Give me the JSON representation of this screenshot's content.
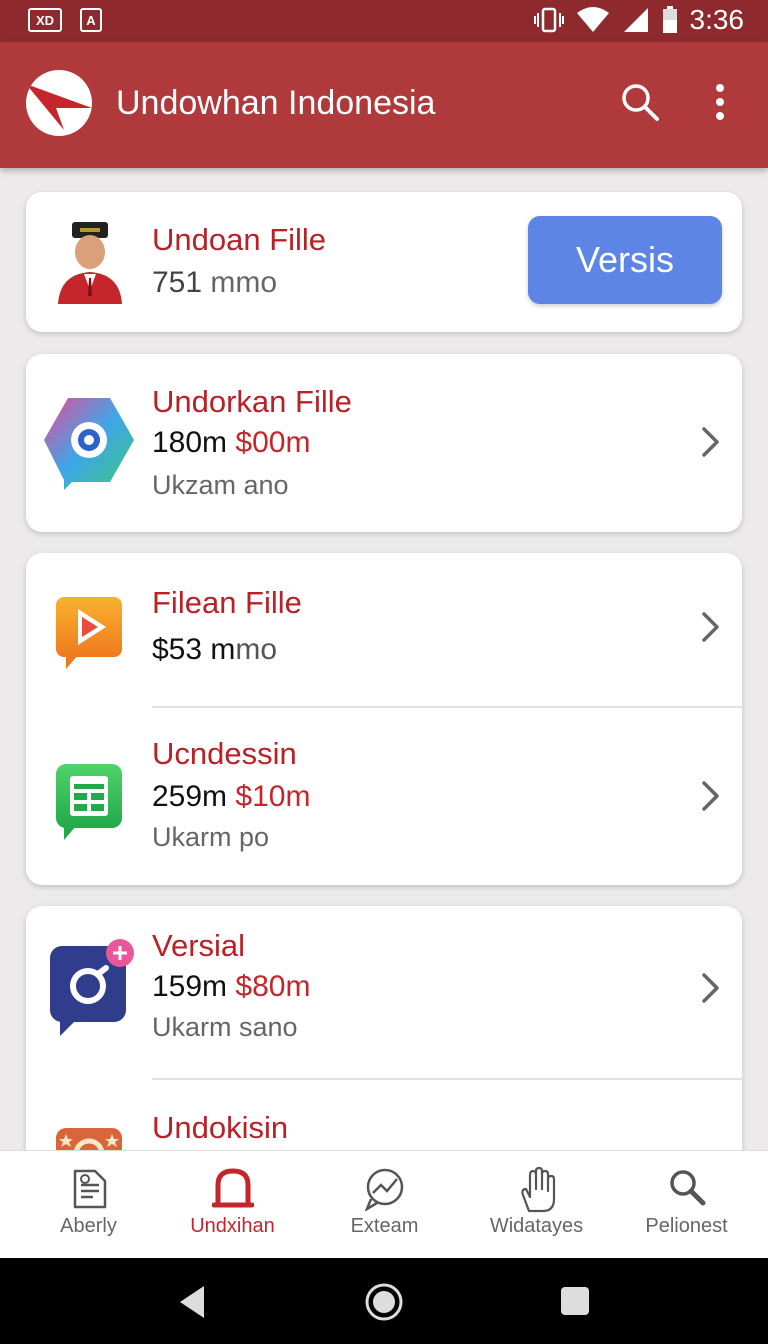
{
  "status_bar": {
    "left_badge_1": "XD",
    "left_badge_2": "A",
    "time": "3:36"
  },
  "app_bar": {
    "title": "Undowhan Indonesia",
    "icons": [
      "logo",
      "search-icon",
      "more-vert-icon"
    ]
  },
  "items": [
    {
      "title": "Undoan Fille",
      "price_a": "751",
      "price_b": "mmo",
      "subtitle": "",
      "action_label": "Versis",
      "icon": "person-avatar"
    },
    {
      "title": "Undorkan Fille",
      "price_a": "180m",
      "price_b": "$00m",
      "subtitle": "Ukzam ano",
      "icon": "hexagon-camera-icon"
    },
    {
      "title": "Filean Fille",
      "price_a": "$53 m",
      "price_b": "mo",
      "subtitle": "",
      "icon": "play-icon"
    },
    {
      "title": "Ucndessin",
      "price_a": "259m",
      "price_b": "$10m",
      "subtitle": "Ukarm po",
      "icon": "table-icon"
    },
    {
      "title": "Versial",
      "price_a": "159m",
      "price_b": "$80m",
      "subtitle": "Ukarm sano",
      "icon": "camera-plus-icon"
    },
    {
      "title": "Undokisin",
      "icon": "camera-star-icon"
    }
  ],
  "bottom_nav": [
    {
      "label": "Aberly",
      "icon": "document-icon",
      "active": false
    },
    {
      "label": "Undxihan",
      "icon": "bell-icon",
      "active": true
    },
    {
      "label": "Exteam",
      "icon": "chart-circle-icon",
      "active": false
    },
    {
      "label": "Widatayes",
      "icon": "hand-icon",
      "active": false
    },
    {
      "label": "Pelionest",
      "icon": "search-icon",
      "active": false
    }
  ],
  "colors": {
    "primary": "#b0393b",
    "status": "#8e2a2d",
    "accent": "#c4262c",
    "button": "#5c85e6"
  }
}
